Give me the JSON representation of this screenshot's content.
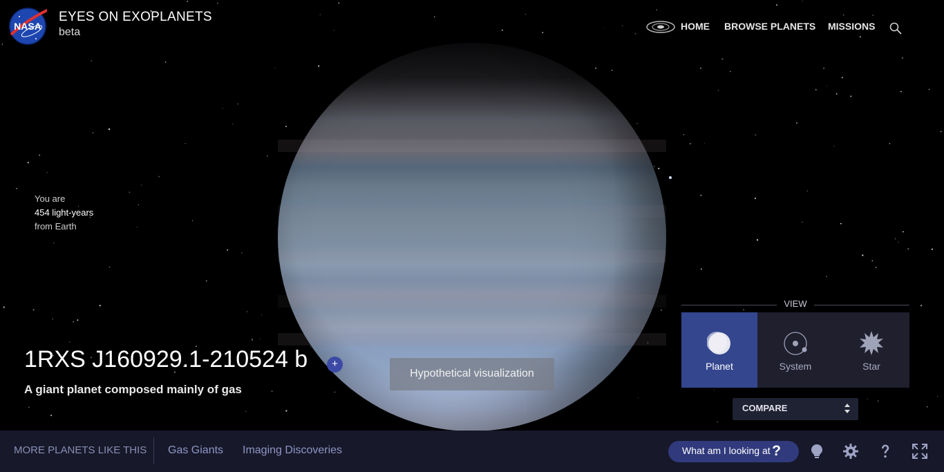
{
  "header": {
    "app_title": "EYES ON EXOPLANETS",
    "app_subtitle": "beta",
    "logo_text": "NASA",
    "nav": [
      {
        "label": "HOME"
      },
      {
        "label": "BROWSE PLANETS"
      },
      {
        "label": "MISSIONS"
      }
    ],
    "icons": {
      "galaxy": "galaxy-icon",
      "search": "search-icon"
    }
  },
  "distance": {
    "line1": "You are",
    "line2": "454 light-years",
    "line3": "from Earth"
  },
  "planet": {
    "name": "1RXS J160929.1-210524 b",
    "add_label": "+",
    "description": "A giant planet composed mainly of gas",
    "overlay_label": "Hypothetical visualization"
  },
  "view_panel": {
    "label": "VIEW",
    "options": [
      {
        "label": "Planet",
        "icon": "planet-icon",
        "active": true
      },
      {
        "label": "System",
        "icon": "system-icon",
        "active": false
      },
      {
        "label": "Star",
        "icon": "star-icon",
        "active": false
      }
    ],
    "compare_label": "COMPARE"
  },
  "bottom_bar": {
    "more_label": "MORE PLANETS LIKE THIS",
    "categories": [
      "Gas Giants",
      "Imaging Discoveries"
    ],
    "help_button": "What am I looking at",
    "help_glyph": "?",
    "icons": [
      "lightbulb-icon",
      "gear-icon",
      "question-icon",
      "fullscreen-icon"
    ]
  },
  "colors": {
    "accent": "#34468e",
    "bottom_bar": "#17182a",
    "category_link": "#8f96c4"
  }
}
